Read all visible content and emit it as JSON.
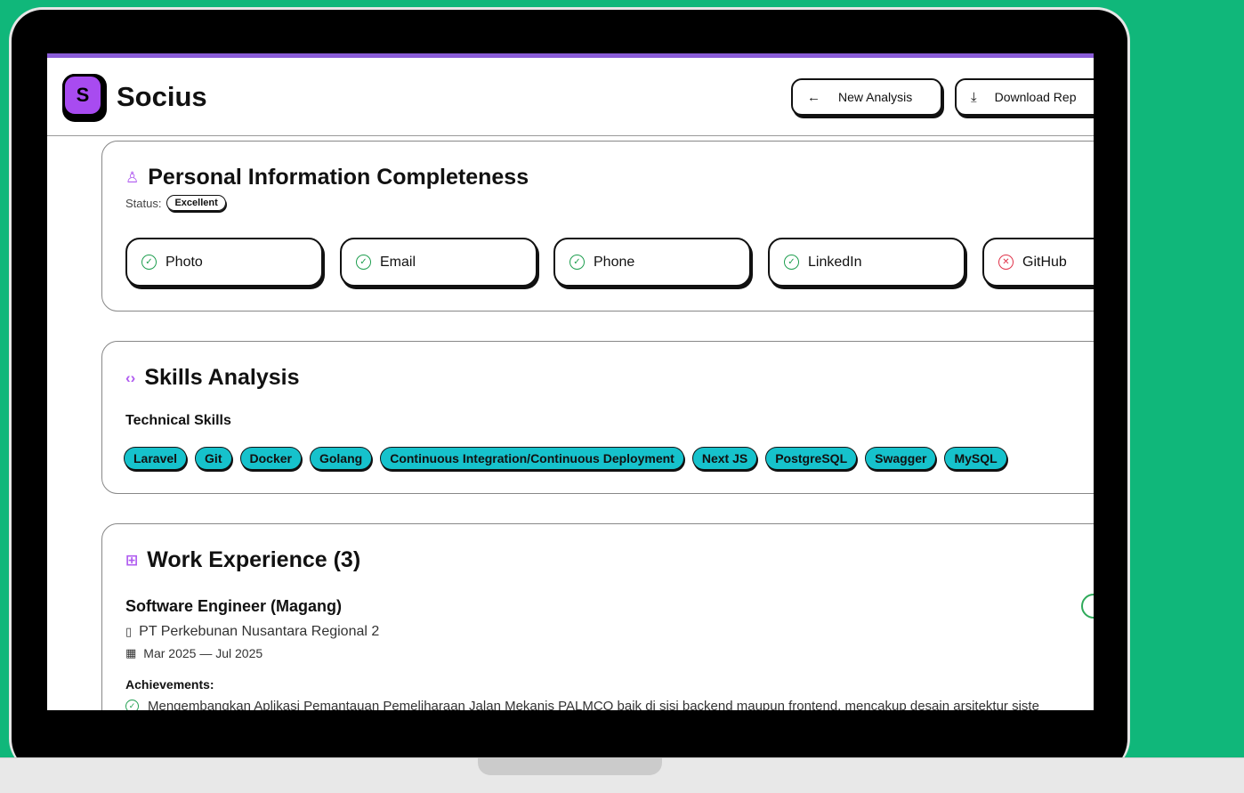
{
  "header": {
    "logo_letter": "S",
    "app_name": "Socius",
    "new_analysis_label": "New Analysis",
    "new_analysis_icon": "←",
    "download_label": "Download Rep",
    "download_icon": "⤓"
  },
  "personal": {
    "title": "Personal Information Completeness",
    "icon": "person-icon",
    "status_label": "Status:",
    "status_value": "Excellent",
    "items": [
      {
        "label": "Photo",
        "ok": true
      },
      {
        "label": "Email",
        "ok": true
      },
      {
        "label": "Phone",
        "ok": true
      },
      {
        "label": "LinkedIn",
        "ok": true
      },
      {
        "label": "GitHub",
        "ok": false
      }
    ]
  },
  "skills": {
    "title": "Skills Analysis",
    "icon": "code-icon",
    "technical_heading": "Technical Skills",
    "technical": [
      "Laravel",
      "Git",
      "Docker",
      "Golang",
      "Continuous Integration/Continuous Deployment",
      "Next JS",
      "PostgreSQL",
      "Swagger",
      "MySQL"
    ]
  },
  "experience": {
    "title": "Work Experience (3)",
    "icon": "briefcase-icon",
    "job_title": "Software Engineer (Magang)",
    "company": "PT Perkebunan Nusantara Regional 2",
    "dates": "Mar 2025 — Jul 2025",
    "achievements_heading": "Achievements:",
    "achievement_1": "Mengembangkan Aplikasi Pemantauan Pemeliharaan Jalan Mekanis PALMCO baik di sisi backend maupun frontend, mencakup desain arsitektur siste"
  },
  "colors": {
    "background": "#10b77a",
    "accent": "#a84bf0",
    "tag": "#16c2cc",
    "ok": "#1e9e4f",
    "bad": "#e0334a"
  }
}
